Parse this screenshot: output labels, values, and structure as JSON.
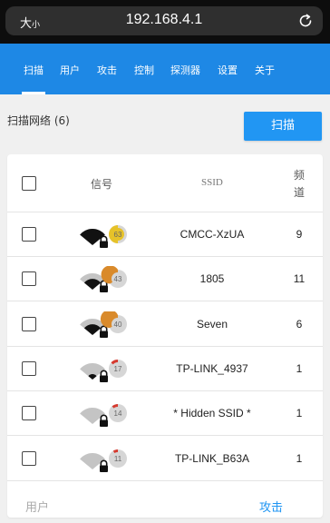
{
  "browser": {
    "text_size_label": "大",
    "text_size_small": "小",
    "url": "192.168.4.1"
  },
  "nav": {
    "items": [
      {
        "label": "扫描",
        "active": true
      },
      {
        "label": "用户",
        "active": false
      },
      {
        "label": "攻击",
        "active": false
      },
      {
        "label": "控制",
        "active": false
      },
      {
        "label": "探测器",
        "active": false
      },
      {
        "label": "设置",
        "active": false
      },
      {
        "label": "关于",
        "active": false
      }
    ]
  },
  "scan": {
    "title": "扫描网络 (6)",
    "button_label": "扫描"
  },
  "table": {
    "headers": {
      "signal": "信号",
      "ssid": "SSID",
      "channel_line1": "频",
      "channel_line2": "道"
    },
    "rows": [
      {
        "ssid": "CMCC-XzUA",
        "channel": "9",
        "strength": 63,
        "level": 1.0,
        "badge_color": "#e6c229"
      },
      {
        "ssid": "1805",
        "channel": "11",
        "strength": 43,
        "level": 0.66,
        "badge_color": "#d98a2b"
      },
      {
        "ssid": "Seven",
        "channel": "6",
        "strength": 40,
        "level": 0.66,
        "badge_color": "#d98a2b"
      },
      {
        "ssid": "TP-LINK_4937",
        "channel": "1",
        "strength": 17,
        "level": 0.33,
        "badge_color": "#d63a2f"
      },
      {
        "ssid": "* Hidden SSID *",
        "channel": "1",
        "strength": 14,
        "level": 0.0,
        "badge_color": "#d63a2f"
      },
      {
        "ssid": "TP-LINK_B63A",
        "channel": "1",
        "strength": 11,
        "level": 0.0,
        "badge_color": "#d63a2f"
      }
    ]
  },
  "bottom": {
    "user_label": "用户",
    "attack_label": "攻击"
  },
  "colors": {
    "nav_bg": "#1e88e5",
    "accent": "#2196f3"
  },
  "icons": {
    "signal": "wifi-lock-icon",
    "reload": "reload-icon"
  }
}
